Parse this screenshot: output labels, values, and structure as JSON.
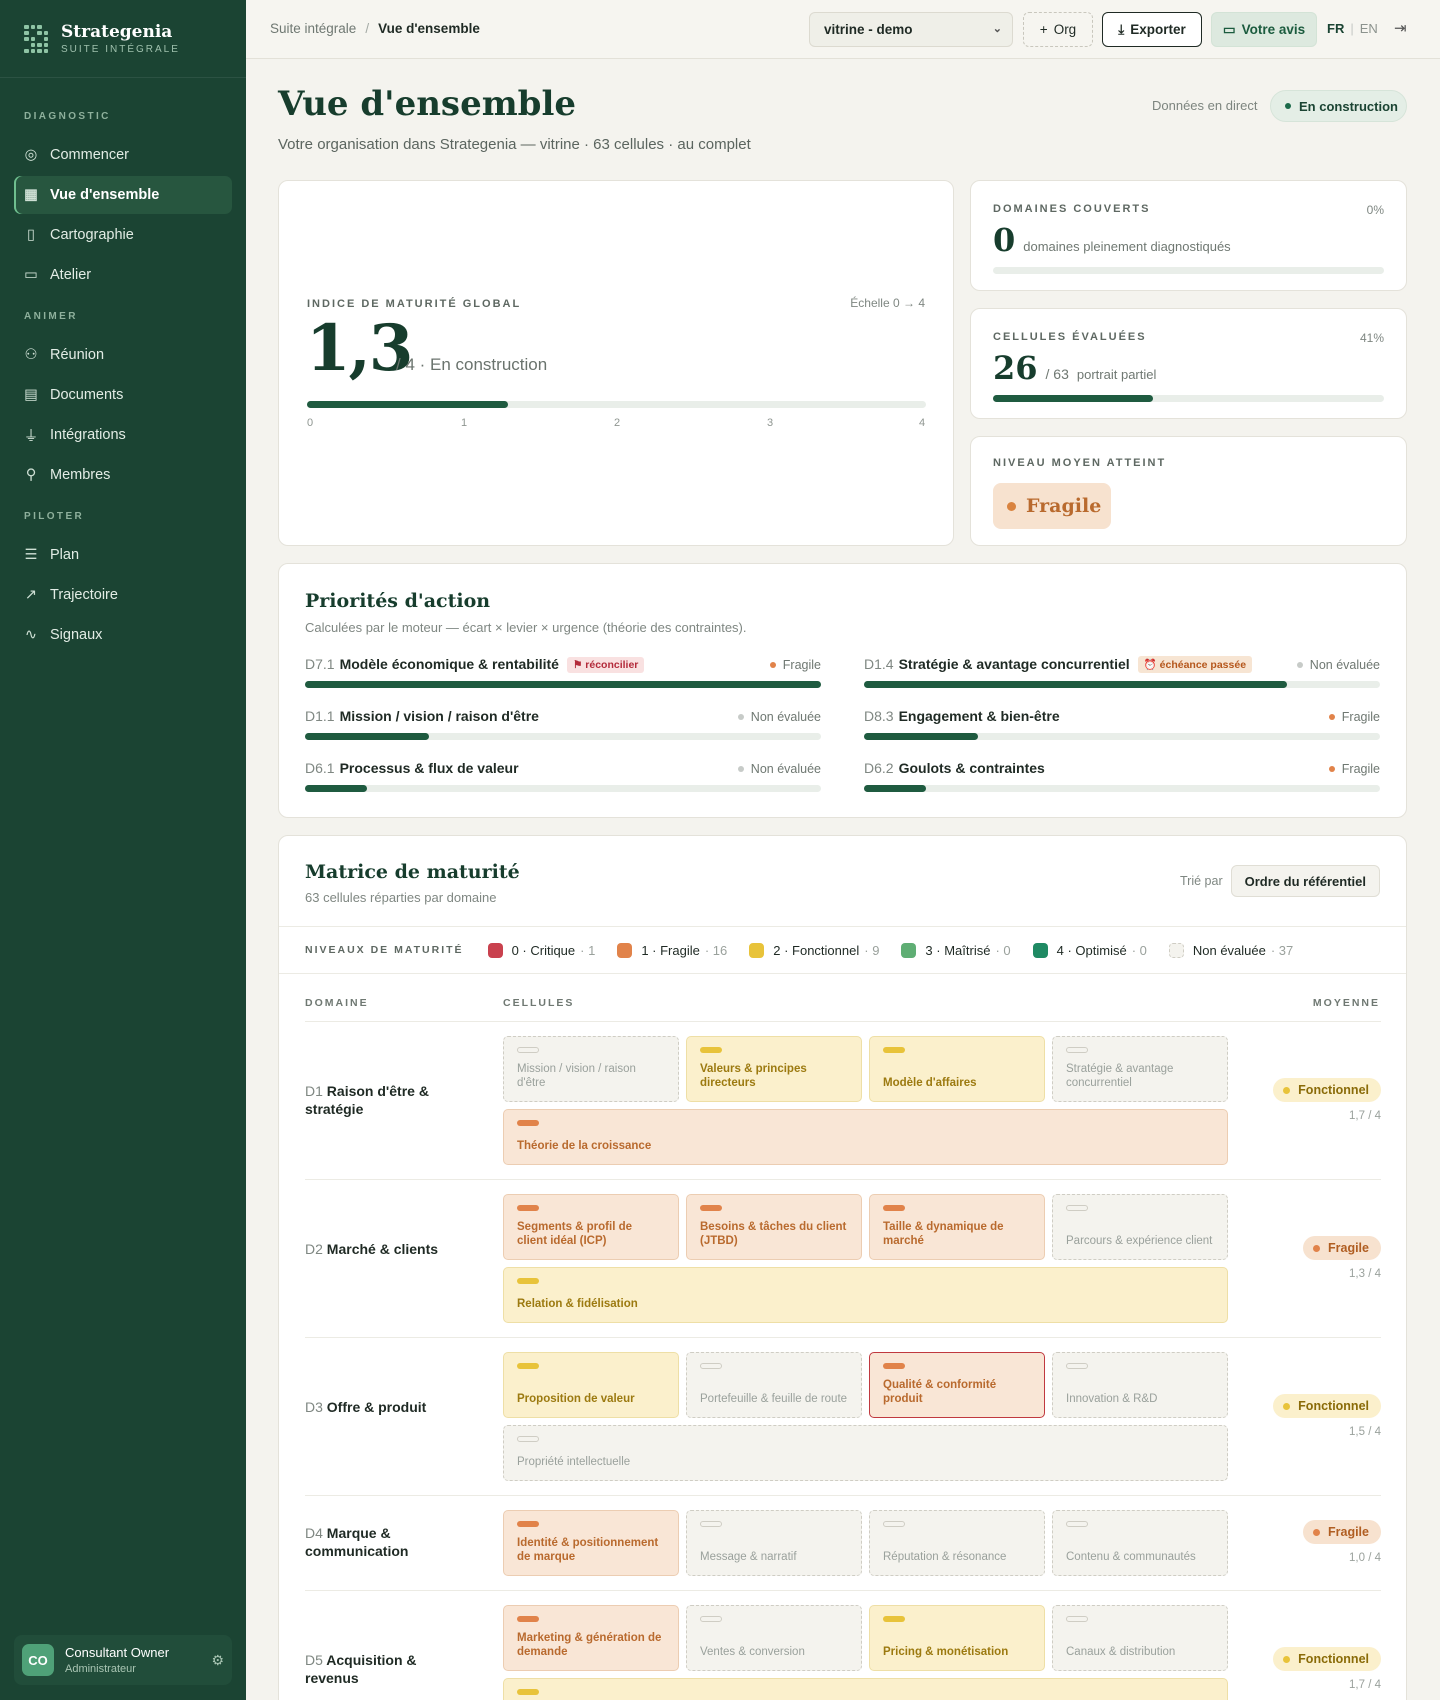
{
  "app": {
    "name": "Strategenia",
    "suite": "SUITE INTÉGRALE"
  },
  "sidebar": {
    "sections": [
      {
        "title": "DIAGNOSTIC",
        "items": [
          {
            "label": "Commencer",
            "icon": "compass-icon"
          },
          {
            "label": "Vue d'ensemble",
            "icon": "grid-icon",
            "active": true
          },
          {
            "label": "Cartographie",
            "icon": "map-icon"
          },
          {
            "label": "Atelier",
            "icon": "chat-icon"
          }
        ]
      },
      {
        "title": "ANIMER",
        "items": [
          {
            "label": "Réunion",
            "icon": "users-icon"
          },
          {
            "label": "Documents",
            "icon": "document-icon"
          },
          {
            "label": "Intégrations",
            "icon": "plug-icon"
          },
          {
            "label": "Membres",
            "icon": "user-plus-icon"
          }
        ]
      },
      {
        "title": "PILOTER",
        "items": [
          {
            "label": "Plan",
            "icon": "list-check-icon"
          },
          {
            "label": "Trajectoire",
            "icon": "trend-icon"
          },
          {
            "label": "Signaux",
            "icon": "pulse-icon"
          }
        ]
      }
    ],
    "user": {
      "initials": "CO",
      "name": "Consultant Owner",
      "role": "Administrateur"
    }
  },
  "topbar": {
    "breadcrumb": [
      "Suite intégrale",
      "Vue d'ensemble"
    ],
    "org_select": "vitrine - demo",
    "org_button": "Org",
    "export_button": "Exporter",
    "feedback_button": "Votre avis",
    "lang_active": "FR",
    "lang_other": "EN"
  },
  "header": {
    "title": "Vue d'ensemble",
    "subtitle": "Votre organisation dans Strategenia — vitrine · 63 cellules · au complet",
    "live": "Données en direct",
    "status": "En construction"
  },
  "maturity": {
    "label": "INDICE DE MATURITÉ GLOBAL",
    "scale": "Échelle 0 → 4",
    "value": "1,3",
    "value_num": 1.3,
    "max": 4,
    "suffix": "/ 4 · En construction",
    "ticks": [
      "0",
      "1",
      "2",
      "3",
      "4"
    ]
  },
  "domains_covered": {
    "label": "DOMAINES COUVERTS",
    "pct": "0%",
    "pct_num": 0,
    "value": "0",
    "desc": "domaines pleinement diagnostiqués"
  },
  "cells_evaluated": {
    "label": "CELLULES ÉVALUÉES",
    "pct": "41%",
    "pct_num": 0.41,
    "value": "26",
    "total": "/ 63",
    "desc": "portrait partiel"
  },
  "avg_level": {
    "label": "NIVEAU MOYEN ATTEINT",
    "value": "Fragile"
  },
  "priorities": {
    "title": "Priorités d'action",
    "subtitle": "Calculées par le moteur — écart × levier × urgence (théorie des contraintes).",
    "items": [
      {
        "code": "D7.1",
        "name": "Modèle économique & rentabilité",
        "tag": "⚑ réconcilier",
        "tag_type": "r",
        "status": "Fragile",
        "progress": 1.0
      },
      {
        "code": "D1.4",
        "name": "Stratégie & avantage concurrentiel",
        "tag": "⏰ échéance passée",
        "tag_type": "e",
        "status": "Non évaluée",
        "progress": 0.82
      },
      {
        "code": "D1.1",
        "name": "Mission / vision / raison d'être",
        "tag": "",
        "status": "Non évaluée",
        "progress": 0.24
      },
      {
        "code": "D8.3",
        "name": "Engagement & bien-être",
        "tag": "",
        "status": "Fragile",
        "progress": 0.22
      },
      {
        "code": "D6.1",
        "name": "Processus & flux de valeur",
        "tag": "",
        "status": "Non évaluée",
        "progress": 0.12
      },
      {
        "code": "D6.2",
        "name": "Goulots & contraintes",
        "tag": "",
        "status": "Fragile",
        "progress": 0.12
      }
    ]
  },
  "matrix": {
    "title": "Matrice de maturité",
    "subtitle": "63 cellules réparties par domaine",
    "sort_label": "Trié par",
    "sort_value": "Ordre du référentiel",
    "legend_label": "NIVEAUX DE MATURITÉ",
    "legend": [
      {
        "label": "0 · Critique",
        "count": "· 1",
        "color": "#c9414e"
      },
      {
        "label": "1 · Fragile",
        "count": "· 16",
        "color": "#e1834a"
      },
      {
        "label": "2 · Fonctionnel",
        "count": "· 9",
        "color": "#e8c33a"
      },
      {
        "label": "3 · Maîtrisé",
        "count": "· 0",
        "color": "#5fae74"
      },
      {
        "label": "4 · Optimisé",
        "count": "· 0",
        "color": "#1f8a63"
      },
      {
        "label": "Non évaluée",
        "count": "· 37",
        "color": "#f4f3ee"
      }
    ],
    "col_domain": "DOMAINE",
    "col_cells": "CELLULES",
    "col_avg": "MOYENNE",
    "domains": [
      {
        "code": "D1",
        "name": "Raison d'être & stratégie",
        "avg_label": "Fonctionnel",
        "avg": "1,7 / 4",
        "cells": [
          {
            "n": "Mission / vision / raison d'être",
            "s": "n"
          },
          {
            "n": "Valeurs & principes directeurs",
            "s": "fo"
          },
          {
            "n": "Modèle d'affaires",
            "s": "fo"
          },
          {
            "n": "Stratégie & avantage concurrentiel",
            "s": "n"
          },
          {
            "n": "Théorie de la croissance",
            "s": "f"
          }
        ]
      },
      {
        "code": "D2",
        "name": "Marché & clients",
        "avg_label": "Fragile",
        "avg": "1,3 / 4",
        "cells": [
          {
            "n": "Segments & profil de client idéal (ICP)",
            "s": "f"
          },
          {
            "n": "Besoins & tâches du client (JTBD)",
            "s": "f"
          },
          {
            "n": "Taille & dynamique de marché",
            "s": "f"
          },
          {
            "n": "Parcours & expérience client",
            "s": "n"
          },
          {
            "n": "Relation & fidélisation",
            "s": "fo"
          }
        ]
      },
      {
        "code": "D3",
        "name": "Offre & produit",
        "avg_label": "Fonctionnel",
        "avg": "1,5 / 4",
        "cells": [
          {
            "n": "Proposition de valeur",
            "s": "fo"
          },
          {
            "n": "Portefeuille & feuille de route",
            "s": "n"
          },
          {
            "n": "Qualité & conformité produit",
            "s": "f",
            "sel": true
          },
          {
            "n": "Innovation & R&D",
            "s": "n"
          },
          {
            "n": "Propriété intellectuelle",
            "s": "n"
          }
        ]
      },
      {
        "code": "D4",
        "name": "Marque & communication",
        "avg_label": "Fragile",
        "avg": "1,0 / 4",
        "cells": [
          {
            "n": "Identité & positionnement de marque",
            "s": "f"
          },
          {
            "n": "Message & narratif",
            "s": "n"
          },
          {
            "n": "Réputation & résonance",
            "s": "n"
          },
          {
            "n": "Contenu & communautés",
            "s": "n"
          }
        ]
      },
      {
        "code": "D5",
        "name": "Acquisition & revenus",
        "avg_label": "Fonctionnel",
        "avg": "1,7 / 4",
        "cells": [
          {
            "n": "Marketing & génération de demande",
            "s": "f"
          },
          {
            "n": "Ventes & conversion",
            "s": "n"
          },
          {
            "n": "Pricing & monétisation",
            "s": "fo"
          },
          {
            "n": "Canaux & distribution",
            "s": "n"
          },
          {
            "n": "",
            "s": "fo"
          }
        ]
      }
    ]
  }
}
